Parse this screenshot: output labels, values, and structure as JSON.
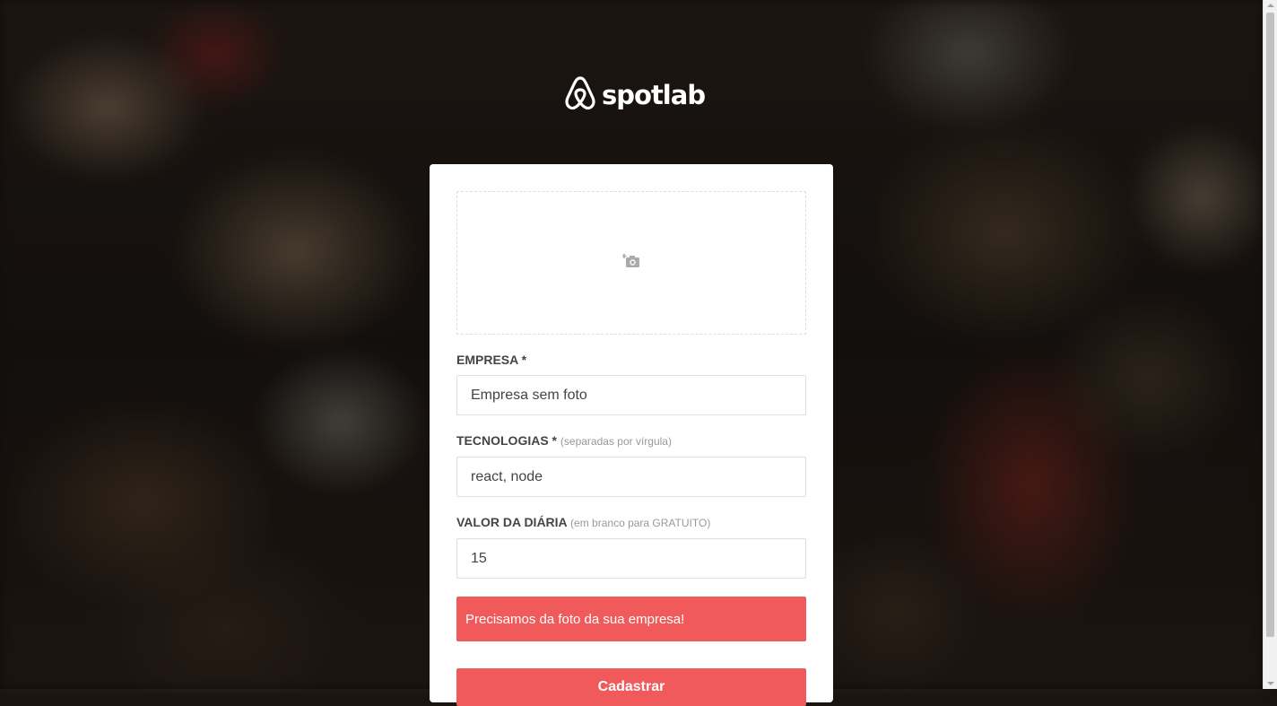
{
  "brand": {
    "name": "spotlab",
    "icon": "airbnb-logo-icon"
  },
  "form": {
    "upload": {
      "icon": "camera-add-icon"
    },
    "company": {
      "label": "EMPRESA *",
      "value": "Empresa sem foto"
    },
    "techs": {
      "label": "TECNOLOGIAS *",
      "hint": "(separadas por vírgula)",
      "value": "react, node"
    },
    "price": {
      "label": "VALOR DA DIÁRIA",
      "hint": "(em branco para GRATUITO)",
      "value": "15"
    },
    "error": "Precisamos da foto da sua empresa!",
    "submit_label": "Cadastrar"
  },
  "colors": {
    "accent": "#f05a5b",
    "label": "#444444",
    "hint": "#999999",
    "border": "#dddddd"
  }
}
